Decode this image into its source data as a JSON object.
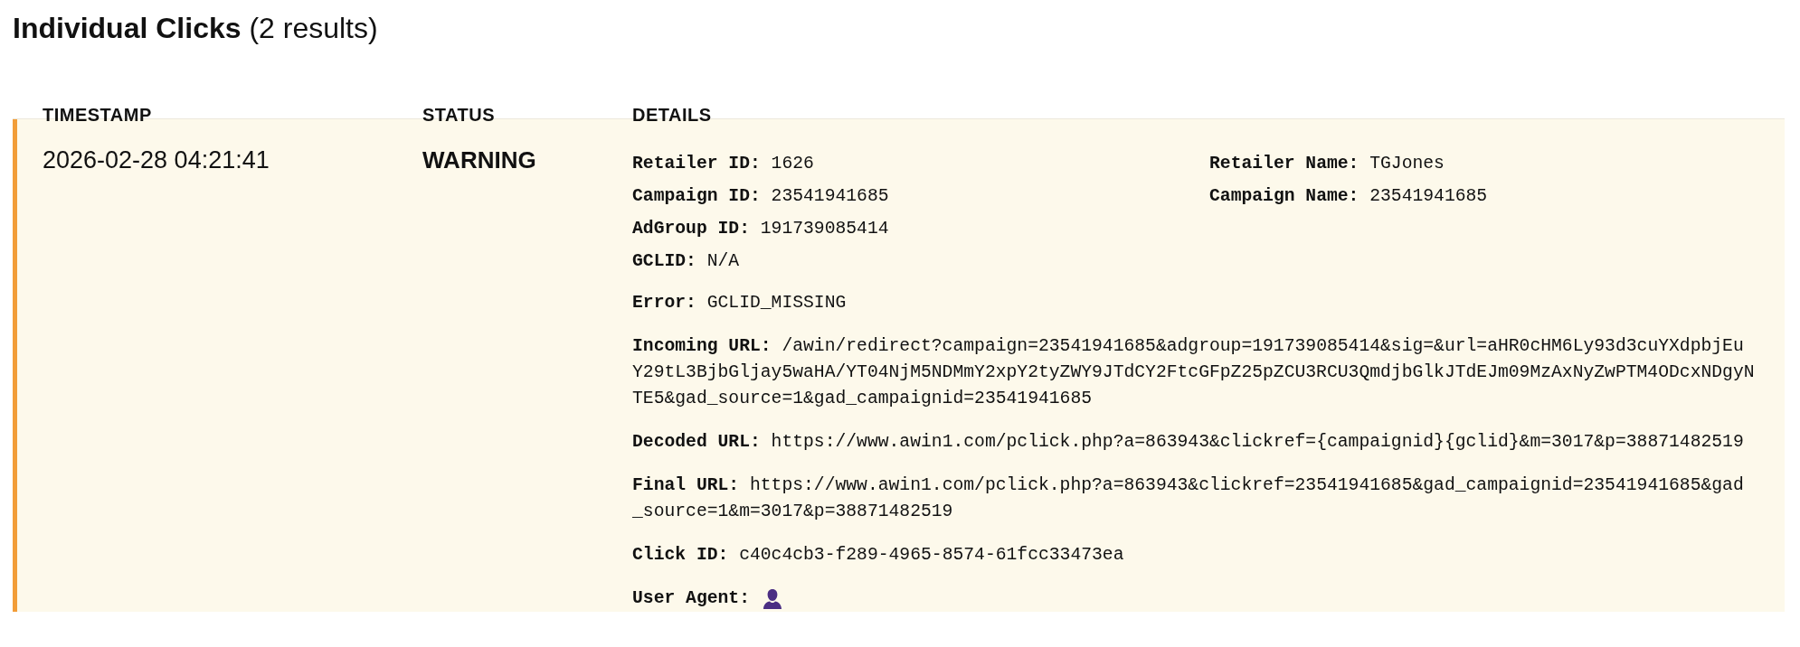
{
  "heading": "**Individual Clicks** (2 results)",
  "table": {
    "columns": [
      "TIMESTAMP",
      "STATUS",
      "DETAILS"
    ],
    "rows": [
      {
        "kind": "warning",
        "timestamp": "2026-02-28 04:21:41",
        "status": "WARNING",
        "left": [
          "**Retailer ID:** 1626",
          "**Campaign ID:** 23541941685",
          "**AdGroup ID:** 191739085414",
          "**GCLID:** N/A"
        ],
        "right": [
          "**Retailer Name:** TGJones",
          "**Campaign Name:** 23541941685"
        ],
        "blocks": [
          "**Error:** GCLID_MISSING",
          "**Incoming URL:** /awin/redirect?campaign=23541941685&adgroup=191739085414&sig=&url=aHR0cHM6Ly93d3cuYXdpbjEuY29tL3BjbGljay5waHA/YT04NjM5NDMmY2xpY2tyZWY9JTdCY2FtcGFpZ25pZCU3RCU3QmdjbGlkJTdEJm09MzAxNyZwPTM4ODcxNDgyNTE5&gad_source=1&gad_campaignid=23541941685",
          "**Decoded URL:** https://www.awin1.com/pclick.php?a=863943&clickref={campaignid}{gclid}&m=3017&p=38871482519",
          "**Final URL:** https://www.awin1.com/pclick.php?a=863943&clickref=23541941685&gad_campaignid=23541941685&gad_source=1&m=3017&p=38871482519",
          "**Click ID:** c40c4cb3-f289-4965-8574-61fcc33473ea"
        ],
        "user_agent": {
          "label": "User Agent:"
        }
      }
    ]
  }
}
